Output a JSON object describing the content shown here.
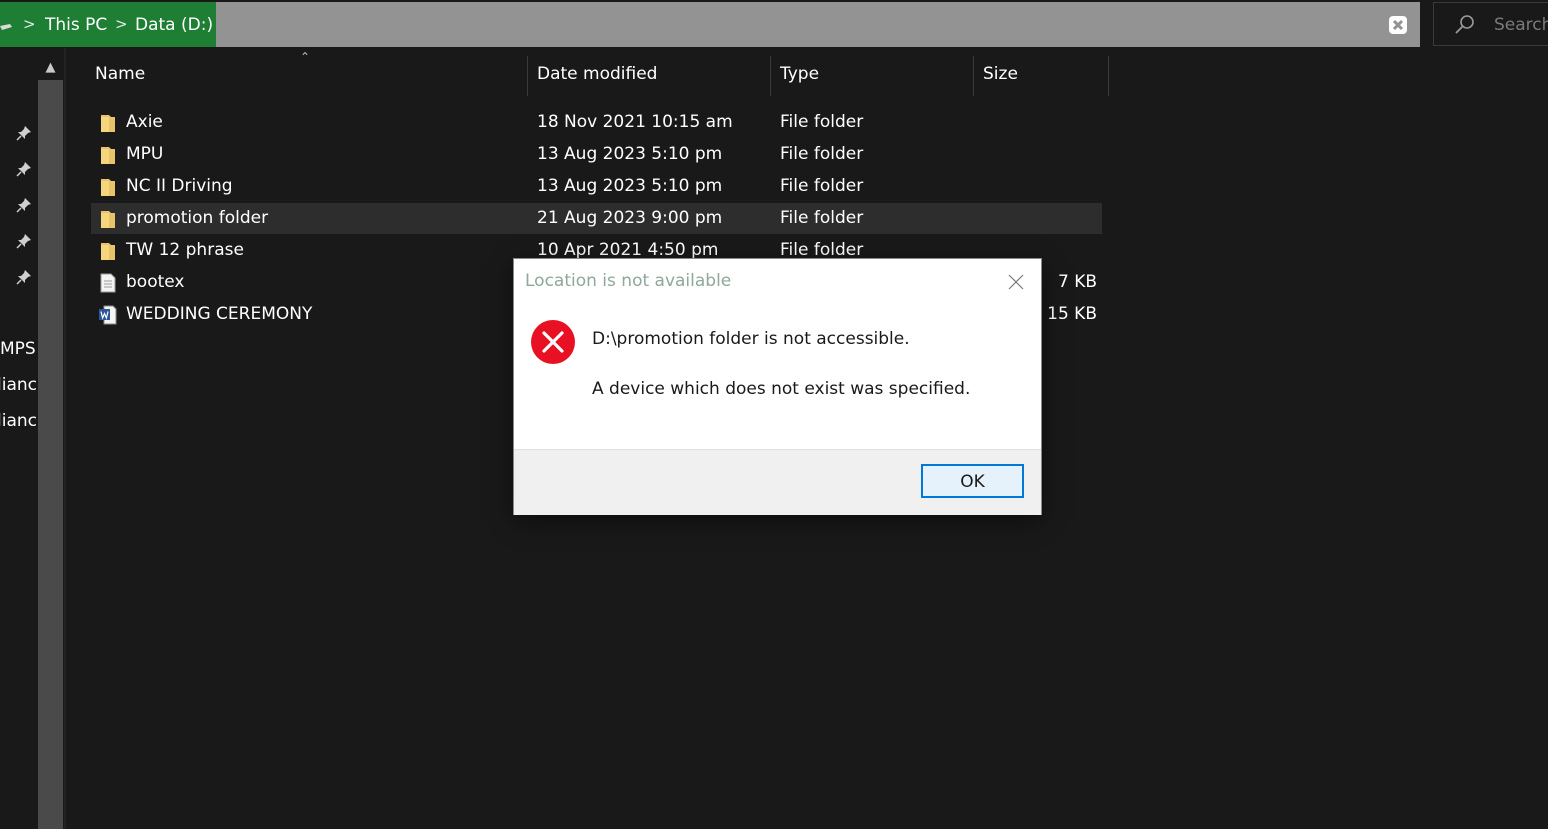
{
  "breadcrumb": {
    "items": [
      "This PC",
      "Data (D:)"
    ],
    "separator": ">"
  },
  "search": {
    "placeholder": "Search"
  },
  "nav": {
    "labels": [
      "MPS",
      "lianc",
      "lianc"
    ]
  },
  "columns": {
    "name": "Name",
    "date": "Date modified",
    "type": "Type",
    "size": "Size"
  },
  "files": [
    {
      "name": "Axie",
      "date": "18 Nov 2021 10:15 am",
      "type": "File folder",
      "size": "",
      "icon": "folder-icon"
    },
    {
      "name": "MPU",
      "date": "13 Aug 2023 5:10 pm",
      "type": "File folder",
      "size": "",
      "icon": "folder-icon"
    },
    {
      "name": "NC II Driving",
      "date": "13 Aug 2023 5:10 pm",
      "type": "File folder",
      "size": "",
      "icon": "folder-icon"
    },
    {
      "name": "promotion folder",
      "date": "21 Aug 2023 9:00 pm",
      "type": "File folder",
      "size": "",
      "icon": "folder-icon",
      "selected": true
    },
    {
      "name": "TW 12 phrase",
      "date": "10 Apr 2021 4:50 pm",
      "type": "File folder",
      "size": "",
      "icon": "folder-icon"
    },
    {
      "name": "bootex",
      "date": "",
      "type": "",
      "size": "7 KB",
      "icon": "text-file-icon"
    },
    {
      "name": "WEDDING CEREMONY",
      "date": "",
      "type": "",
      "size": "15 KB",
      "icon": "word-doc-icon"
    }
  ],
  "dialog": {
    "title": "Location is not available",
    "message": "D:\\promotion folder is not accessible.",
    "detail": "A device which does not exist was specified.",
    "ok_label": "OK",
    "icon": "error-icon"
  },
  "colors": {
    "breadcrumb_bg": "#1e7e34",
    "address_bg": "#939393",
    "background": "#191919",
    "selected_row": "#2d2d2d",
    "error_red": "#e81123",
    "button_border": "#0078d7"
  }
}
